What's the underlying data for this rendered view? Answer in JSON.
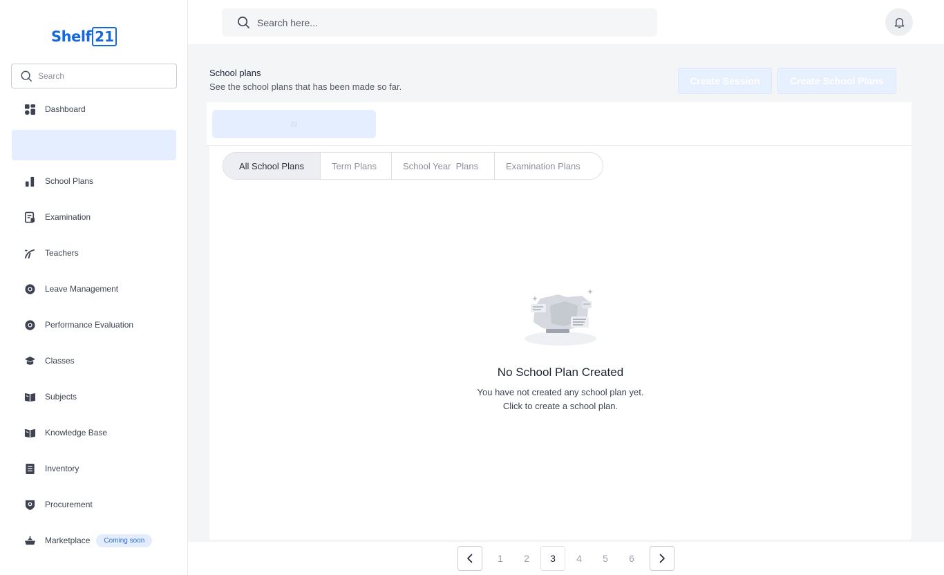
{
  "brand": {
    "name": "Shelf",
    "suffix": "21"
  },
  "sidebar": {
    "search_placeholder": "Search",
    "items": [
      {
        "label": "Dashboard",
        "icon": "dashboard-icon"
      },
      {
        "label": "School Plans",
        "icon": "bar-chart-icon"
      },
      {
        "label": "Examination",
        "icon": "exam-sheet-icon"
      },
      {
        "label": "Teachers",
        "icon": "teacher-pointer-icon"
      },
      {
        "label": "Leave Management",
        "icon": "lifebuoy-icon"
      },
      {
        "label": "Performance Evaluation",
        "icon": "lifebuoy-icon"
      },
      {
        "label": "Classes",
        "icon": "graduation-cap-icon"
      },
      {
        "label": "Subjects",
        "icon": "open-book-icon"
      },
      {
        "label": "Knowledge Base",
        "icon": "open-book-icon"
      },
      {
        "label": "Inventory",
        "icon": "notebook-icon"
      },
      {
        "label": "Procurement",
        "icon": "shield-badge-icon"
      },
      {
        "label": "Marketplace",
        "icon": "ship-icon",
        "badge": "Coming soon"
      }
    ]
  },
  "topbar": {
    "search_placeholder": "Search here...",
    "notification_icon": "bell-icon"
  },
  "header": {
    "title": "School plans",
    "subtitle": "See the school plans that has been made so far.",
    "create_session_label": "Create Session",
    "create_plans_label": "Create School Plans"
  },
  "filter": {
    "pill_text": "22"
  },
  "tabs": [
    {
      "label": "All School Plans",
      "active": true
    },
    {
      "label": "Term Plans",
      "active": false
    },
    {
      "label": "School Year  Plans",
      "active": false
    },
    {
      "label": "Examination Plans",
      "active": false
    }
  ],
  "empty_state": {
    "title": "No School Plan Created",
    "line1": "You have not created any school plan yet.",
    "line2": "Click to create a school plan."
  },
  "pagination": {
    "pages": [
      "1",
      "2",
      "3",
      "4",
      "5",
      "6"
    ],
    "current": "3"
  },
  "colors": {
    "brand": "#1667d9",
    "accent_light": "#e4eefe",
    "badge_text": "#2f6fd6"
  }
}
